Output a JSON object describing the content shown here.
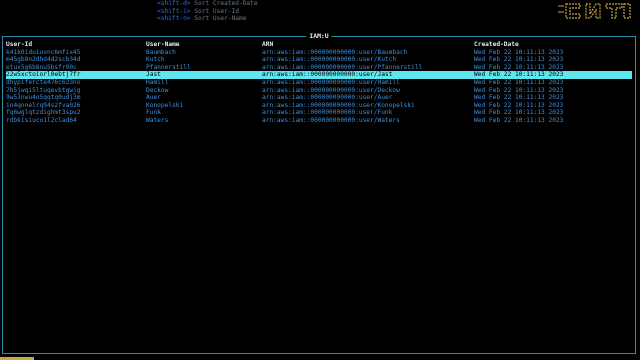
{
  "hints": [
    {
      "key": "<shift-d>",
      "desc": "Sort Created-Date"
    },
    {
      "key": "<shift-i>",
      "desc": "Sort User-Id"
    },
    {
      "key": "<shift-n>",
      "desc": "Sort User-Name"
    }
  ],
  "panel": {
    "title": "IAM:U"
  },
  "table": {
    "columns": [
      "User-Id",
      "User-Name",
      "ARN",
      "Created-Date"
    ],
    "rows": [
      {
        "id": "k41k0idu1uvnc6mfix45",
        "name": "Baumbach",
        "arn": "arn:aws:iam::000000000000:user/Baumbach",
        "date": "Wed Feb 22 10:11:13 2023"
      },
      {
        "id": "m45gb8n2dhd4d2scb34d",
        "name": "Kutch",
        "arn": "arn:aws:iam::000000000000:user/Kutch",
        "date": "Wed Feb 22 10:11:13 2023"
      },
      {
        "id": "etux5g6b8nu5bsfr90c",
        "name": "Pfannerstill",
        "arn": "arn:aws:iam::000000000000:user/Pfannerstill",
        "date": "Wed Feb 22 10:11:13 2023"
      },
      {
        "id": "22w5xctoiorl0ebtj7fr",
        "name": "Jast",
        "arn": "arn:aws:iam::000000000000:user/Jast",
        "date": "Wed Feb 22 10:11:13 2023"
      },
      {
        "id": "dhypifercte476c623no",
        "name": "Hamill",
        "arn": "arn:aws:iam::000000000000:user/Hamill",
        "date": "Wed Feb 22 10:11:13 2023"
      },
      {
        "id": "7b5jwqi5ltuqevbtgwjg",
        "name": "Deckow",
        "arn": "arn:aws:iam::000000000000:user/Deckow",
        "date": "Wed Feb 22 10:11:13 2023"
      },
      {
        "id": "9w53nwu4o5qqtq0udj3m",
        "name": "Auer",
        "arn": "arn:aws:iam::000000000000:user/Auer",
        "date": "Wed Feb 22 10:11:13 2023"
      },
      {
        "id": "in4qnnelrq94s2fva026",
        "name": "Konopelski",
        "arn": "arn:aws:iam::000000000000:user/Konopelski",
        "date": "Wed Feb 22 10:11:13 2023"
      },
      {
        "id": "fq6wglqtzdighmt3spu2",
        "name": "Funk",
        "arn": "arn:aws:iam::000000000000:user/Funk",
        "date": "Wed Feb 22 10:11:13 2023"
      },
      {
        "id": "rdbkisiuco1l2clad64",
        "name": "Waters",
        "arn": "arn:aws:iam::000000000000:user/Waters",
        "date": "Wed Feb 22 10:11:13 2023"
      }
    ],
    "selected_index": 3
  },
  "colors": {
    "accent": "#2b8ea8",
    "selection": "#5ee7ee",
    "key": "#2f6bff",
    "row_text": "#3f8fd9",
    "logo": "#c7a54a"
  },
  "icons": {
    "logo": "app-logo-icon"
  }
}
